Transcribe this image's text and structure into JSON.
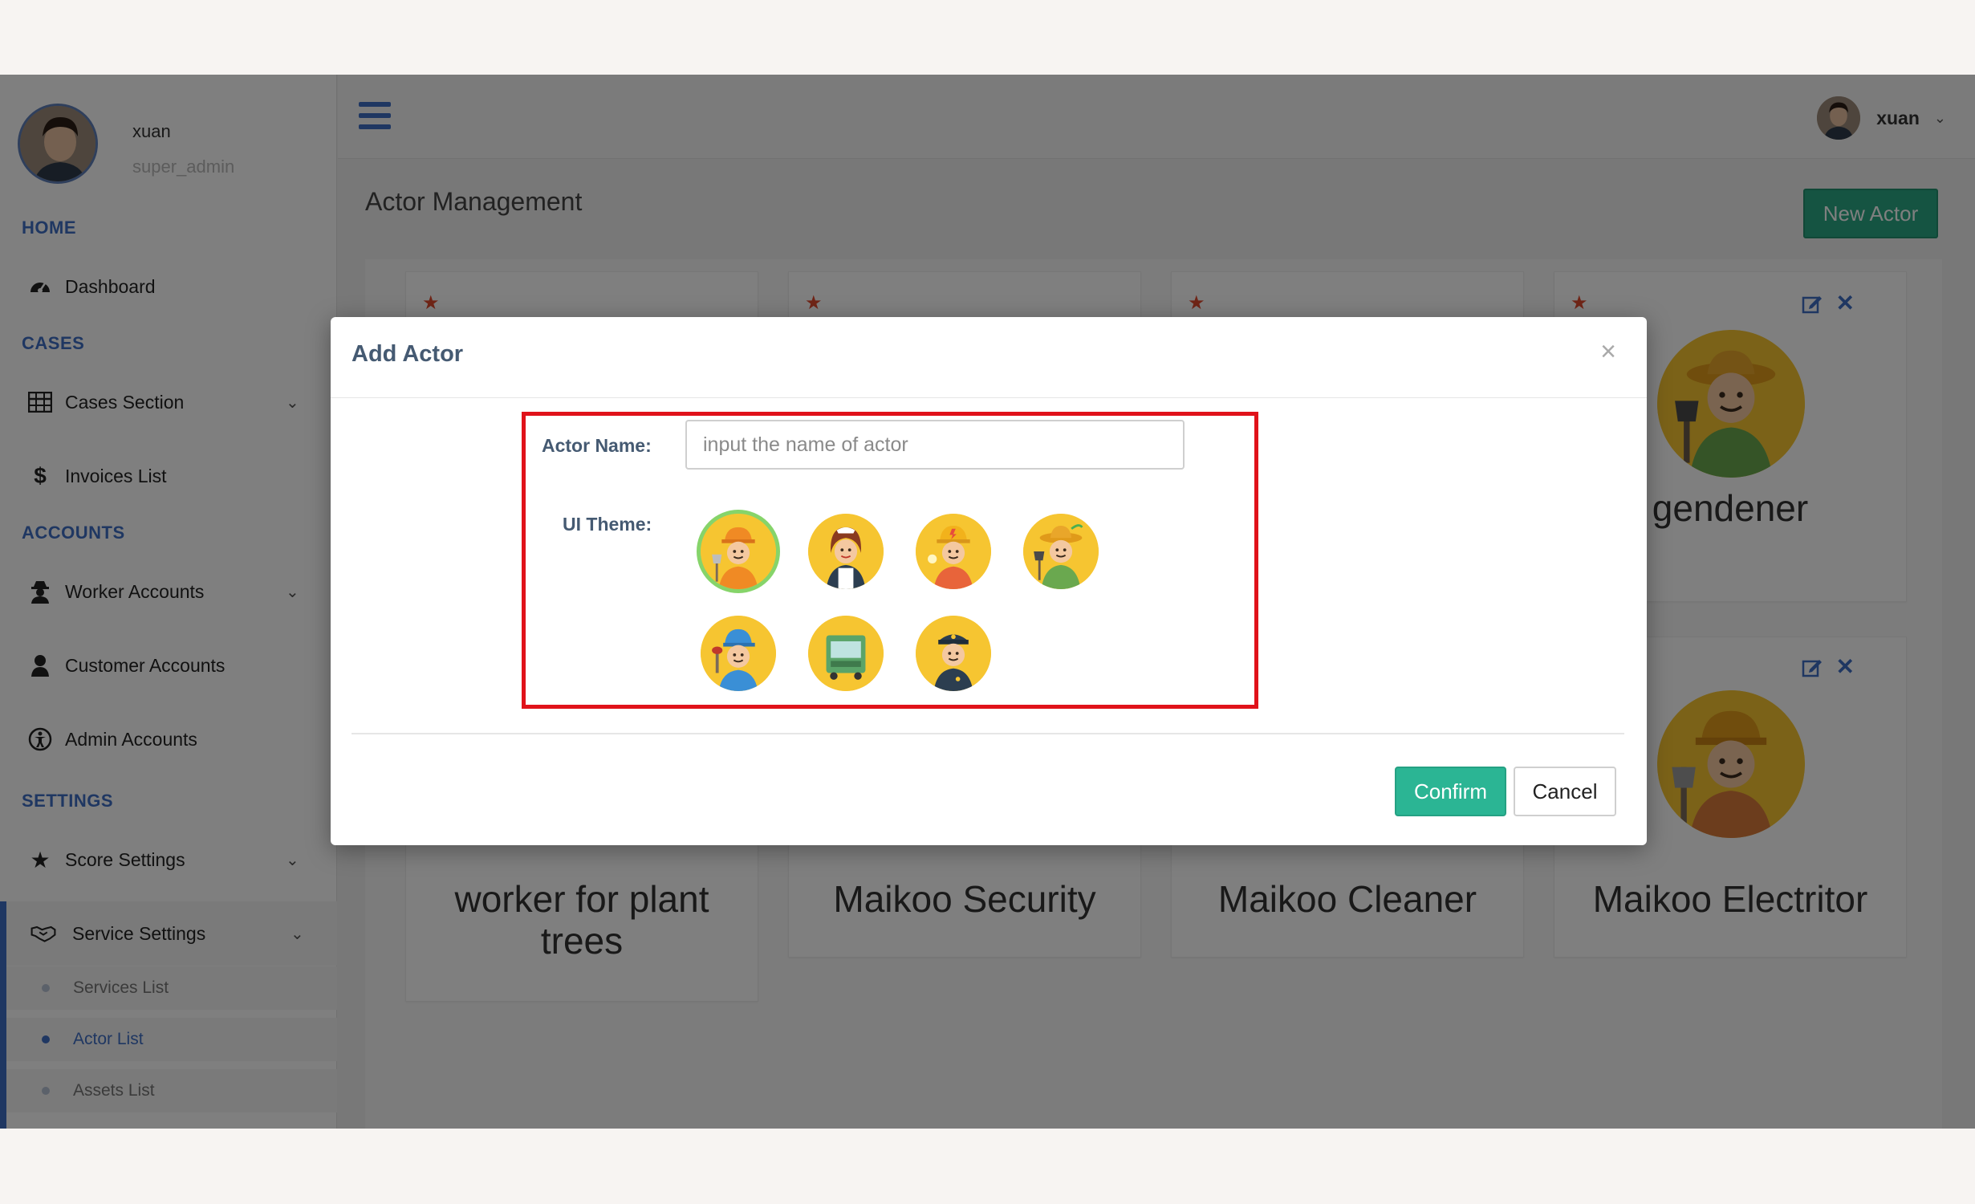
{
  "sidebar": {
    "user_name": "xuan",
    "user_role": "super_admin",
    "sections": {
      "home": "HOME",
      "cases": "CASES",
      "accounts": "ACCOUNTS",
      "settings": "SETTINGS"
    },
    "items": {
      "dashboard": "Dashboard",
      "cases_section": "Cases Section",
      "invoices_list": "Invoices List",
      "worker_accounts": "Worker Accounts",
      "customer_accounts": "Customer Accounts",
      "admin_accounts": "Admin Accounts",
      "score_settings": "Score Settings",
      "service_settings": "Service Settings"
    },
    "sub_items": {
      "services_list": "Services List",
      "actor_list": "Actor List",
      "assets_list": "Assets List"
    },
    "icons": {
      "dashboard": "dashboard-gauge-icon",
      "cases_section": "table-grid-icon",
      "invoices_list": "dollar-icon",
      "worker_accounts": "user-secret-icon",
      "customer_accounts": "user-icon",
      "admin_accounts": "universal-access-icon",
      "score_settings": "star-icon",
      "service_settings": "handshake-icon"
    }
  },
  "topbar": {
    "user_name": "xuan"
  },
  "page": {
    "title": "Actor Management",
    "new_button": "New Actor"
  },
  "cards": [
    {
      "name": "worker for plant trees"
    },
    {
      "name": "Maikoo Security"
    },
    {
      "name": "Maikoo Cleaner"
    },
    {
      "name": "Maikoo Electritor"
    },
    {
      "name": "gendener"
    }
  ],
  "modal": {
    "title": "Add Actor",
    "close": "×",
    "actor_name_label": "Actor Name:",
    "actor_name_placeholder": "input the name of actor",
    "actor_name_value": "",
    "ui_theme_label": "UI Theme:",
    "theme_options": [
      "worker",
      "cleaner-woman",
      "electrician",
      "gardener",
      "plumber",
      "truck",
      "security-guard"
    ],
    "selected_theme": "worker",
    "confirm_label": "Confirm",
    "cancel_label": "Cancel"
  },
  "colors": {
    "accent_blue": "#3f6ec4",
    "confirm_green": "#2bb594",
    "new_button_green": "#2aa885",
    "highlight_red": "#e0121a",
    "avatar_yellow": "#f6c531",
    "selected_ring": "#86d46a"
  }
}
